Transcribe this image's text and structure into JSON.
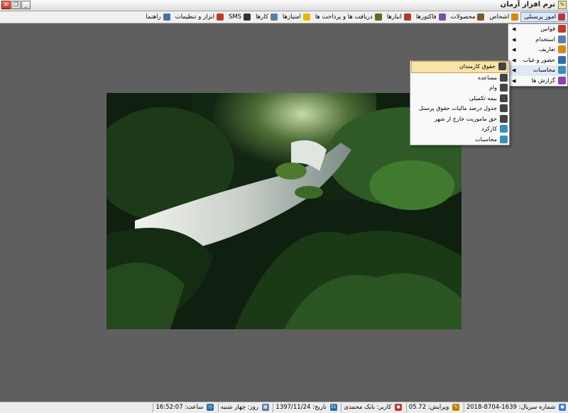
{
  "window": {
    "title": "نرم افزار آرمان",
    "buttons": {
      "minimize": "_",
      "restore": "❐",
      "close": "✕"
    }
  },
  "menubar": {
    "items": [
      {
        "label": "امور پرسنلی",
        "icon": "people-icon",
        "color": "#c0392b"
      },
      {
        "label": "اشخاص",
        "icon": "persons-icon",
        "color": "#d68910"
      },
      {
        "label": "محصولات",
        "icon": "box-icon",
        "color": "#7d5a2c"
      },
      {
        "label": "فاکتورها",
        "icon": "invoice-icon",
        "color": "#7a4fa6"
      },
      {
        "label": "انبارها",
        "icon": "warehouse-icon",
        "color": "#b03a2e"
      },
      {
        "label": "دریافت ها و پرداخت ها",
        "icon": "payment-icon",
        "color": "#5d6d1e"
      },
      {
        "label": "امتیازها",
        "icon": "star-icon",
        "color": "#e5b800"
      },
      {
        "label": "کارها",
        "icon": "tasks-icon",
        "color": "#5a7fa8"
      },
      {
        "label": "SMS",
        "icon": "sms-icon",
        "color": "#333333"
      },
      {
        "label": "ابزار و تنظیمات",
        "icon": "tools-icon",
        "color": "#c0392b"
      },
      {
        "label": "راهنما",
        "icon": "help-icon",
        "color": "#4a6fa5"
      }
    ]
  },
  "personnel_menu": {
    "items": [
      {
        "label": "قوانین",
        "icon": "rules-icon",
        "color": "#c0392b"
      },
      {
        "label": "استخدام",
        "icon": "hire-icon",
        "color": "#5a7fa8"
      },
      {
        "label": "تعاریف",
        "icon": "definitions-icon",
        "color": "#d68910"
      },
      {
        "label": "حضور و غیاب",
        "icon": "clock-icon",
        "color": "#2e6da4"
      },
      {
        "label": "محاسبات",
        "icon": "calculator-icon",
        "color": "#3a8fb7"
      },
      {
        "label": "گزارش ها",
        "icon": "report-icon",
        "color": "#8e44ad"
      }
    ]
  },
  "calc_submenu": {
    "items": [
      {
        "label": "حقوق کارمندان",
        "icon": "employee-icon",
        "color": "#444444"
      },
      {
        "label": "مساعده",
        "icon": "employee-icon",
        "color": "#444444"
      },
      {
        "label": "وام",
        "icon": "employee-icon",
        "color": "#444444"
      },
      {
        "label": "بیمه تکمیلی",
        "icon": "employee-icon",
        "color": "#444444"
      },
      {
        "label": "جدول درصد مالیات حقوق پرسنل",
        "icon": "employee-icon",
        "color": "#444444"
      },
      {
        "label": "حق ماموریت خارج از شهر",
        "icon": "employee-icon",
        "color": "#444444"
      },
      {
        "label": "کارکرد",
        "icon": "worktime-icon",
        "color": "#3a8fb7"
      },
      {
        "label": "محاسبات",
        "icon": "calculator-icon",
        "color": "#3a8fb7"
      }
    ]
  },
  "statusbar": {
    "serial": "شماره سریال: 1639-8704-2018",
    "version": "ویرایش: 05.72",
    "user": "کاربر: بابک محمدی",
    "date": "تاریخ: 1397/11/24",
    "day": "روز: چهار شنبه",
    "time": "ساعت: 16:52:07"
  }
}
